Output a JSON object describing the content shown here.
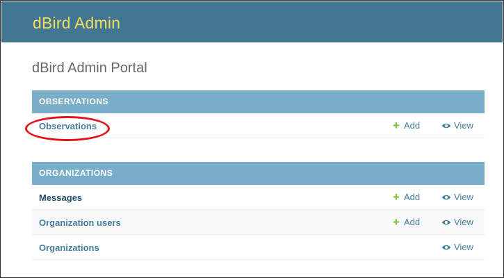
{
  "site": {
    "title": "dBird Admin"
  },
  "page": {
    "title": "dBird Admin Portal"
  },
  "modules": [
    {
      "header": "OBSERVATIONS",
      "rows": [
        {
          "name": "Observations",
          "add_label": "Add",
          "view_label": "View"
        }
      ]
    },
    {
      "header": "ORGANIZATIONS",
      "rows": [
        {
          "name": "Messages",
          "add_label": "Add",
          "view_label": "View"
        },
        {
          "name": "Organization users",
          "add_label": "Add",
          "view_label": "View"
        },
        {
          "name": "Organizations",
          "view_label": "View"
        }
      ]
    }
  ],
  "colors": {
    "header_bg": "#417690",
    "site_title": "#f5dd5d",
    "module_header_bg": "#79aec8",
    "link": "#447e9b",
    "add_icon": "#70bf2b",
    "annotation": "#e3111b"
  },
  "icons": {
    "add": "plus-icon",
    "view": "eye-icon"
  }
}
